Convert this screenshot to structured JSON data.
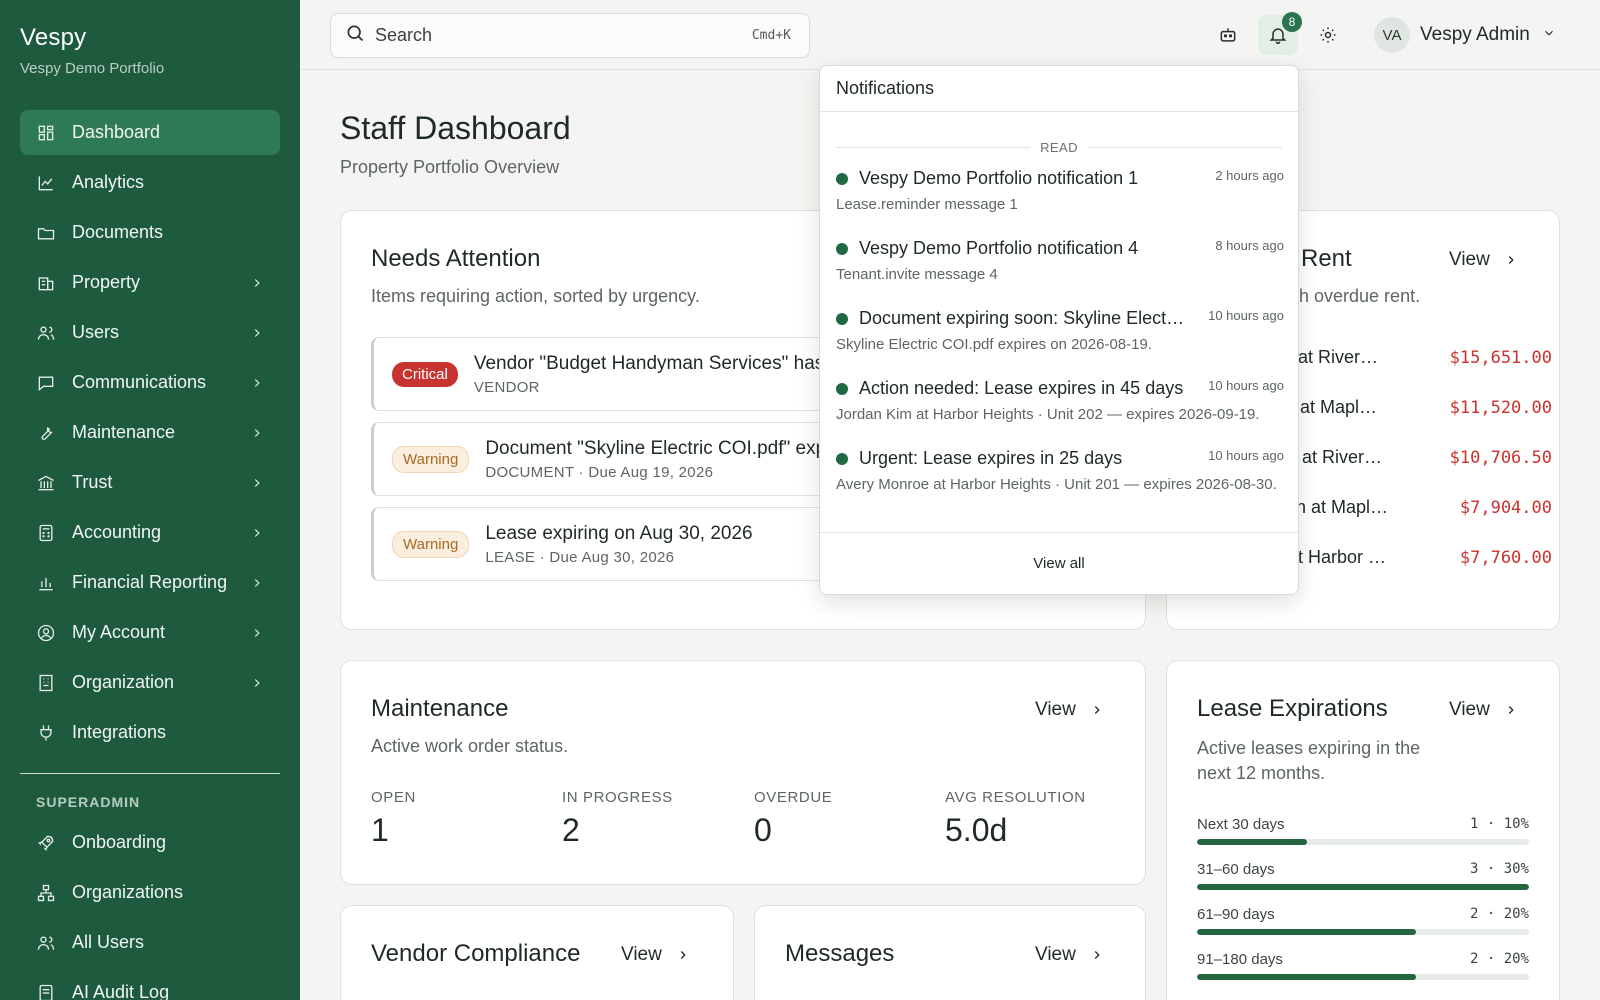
{
  "brand": {
    "title": "Vespy",
    "subtitle": "Vespy Demo Portfolio"
  },
  "sidebar": {
    "items": [
      {
        "label": "Dashboard",
        "icon": "dashboard-icon",
        "active": true,
        "chevron": false
      },
      {
        "label": "Analytics",
        "icon": "chart-line-icon",
        "chevron": false
      },
      {
        "label": "Documents",
        "icon": "folder-icon",
        "chevron": false
      },
      {
        "label": "Property",
        "icon": "building-icon",
        "chevron": true
      },
      {
        "label": "Users",
        "icon": "users-icon",
        "chevron": true
      },
      {
        "label": "Communications",
        "icon": "message-icon",
        "chevron": true
      },
      {
        "label": "Maintenance",
        "icon": "wrench-icon",
        "chevron": true
      },
      {
        "label": "Trust",
        "icon": "bank-icon",
        "chevron": true
      },
      {
        "label": "Accounting",
        "icon": "calculator-icon",
        "chevron": true
      },
      {
        "label": "Financial Reporting",
        "icon": "bar-chart-icon",
        "chevron": true
      },
      {
        "label": "My Account",
        "icon": "user-circle-icon",
        "chevron": true
      },
      {
        "label": "Organization",
        "icon": "office-icon",
        "chevron": true
      },
      {
        "label": "Integrations",
        "icon": "plug-icon",
        "chevron": false
      }
    ],
    "section_label": "SUPERADMIN",
    "admin_items": [
      {
        "label": "Onboarding",
        "icon": "rocket-icon"
      },
      {
        "label": "Organizations",
        "icon": "hierarchy-icon"
      },
      {
        "label": "All Users",
        "icon": "users-icon"
      },
      {
        "label": "AI Audit Log",
        "icon": "log-icon"
      }
    ]
  },
  "topbar": {
    "search_placeholder": "Search",
    "search_shortcut": "Cmd+K",
    "notification_count": "8",
    "user_initials": "VA",
    "user_name": "Vespy Admin"
  },
  "page": {
    "title": "Staff Dashboard",
    "subtitle": "Property Portfolio Overview"
  },
  "needs_attention": {
    "title": "Needs Attention",
    "subtitle": "Items requiring action, sorted by urgency.",
    "items": [
      {
        "severity": "Critical",
        "title": "Vendor \"Budget Handyman Services\" has",
        "meta": "VENDOR"
      },
      {
        "severity": "Warning",
        "title": "Document \"Skyline Electric COI.pdf\" exp",
        "meta": "DOCUMENT   · Due Aug 19, 2026"
      },
      {
        "severity": "Warning",
        "title": "Lease expiring on Aug 30, 2026",
        "meta": "LEASE   · Due Aug 30, 2026"
      }
    ]
  },
  "overdue_rent": {
    "title": "Rent",
    "view_label": "View",
    "subtitle": "h overdue rent.",
    "rows": [
      {
        "name": "er at River…",
        "amount": "$15,651.00"
      },
      {
        "name": "ks at Mapl…",
        "amount": "$11,520.00"
      },
      {
        "name": "ed at River…",
        "amount": "$10,706.50"
      },
      {
        "name": "yen at Mapl…",
        "amount": "$7,904.00"
      },
      {
        "name": "r at Harbor …",
        "amount": "$7,760.00"
      }
    ]
  },
  "maintenance": {
    "title": "Maintenance",
    "subtitle": "Active work order status.",
    "view_label": "View",
    "stats": [
      {
        "label": "OPEN",
        "value": "1"
      },
      {
        "label": "IN PROGRESS",
        "value": "2"
      },
      {
        "label": "OVERDUE",
        "value": "0"
      },
      {
        "label": "AVG RESOLUTION",
        "value": "5.0d"
      }
    ]
  },
  "lease_expirations": {
    "title": "Lease Expirations",
    "subtitle": "Active leases expiring in the next 12 months.",
    "view_label": "View",
    "rows": [
      {
        "label": "Next 30 days",
        "count": "1 · 10%",
        "fraction": 0.33
      },
      {
        "label": "31–60 days",
        "count": "3 · 30%",
        "fraction": 1.0
      },
      {
        "label": "61–90 days",
        "count": "2 · 20%",
        "fraction": 0.66
      },
      {
        "label": "91–180 days",
        "count": "2 · 20%",
        "fraction": 0.66
      }
    ]
  },
  "vendor_compliance": {
    "title": "Vendor Compliance",
    "view_label": "View"
  },
  "messages": {
    "title": "Messages",
    "view_label": "View"
  },
  "notifications": {
    "title": "Notifications",
    "section_label": "READ",
    "items": [
      {
        "title": "Vespy Demo Portfolio notification 1",
        "time": "2 hours ago",
        "message": "Lease.reminder message 1"
      },
      {
        "title": "Vespy Demo Portfolio notification 4",
        "time": "8 hours ago",
        "message": "Tenant.invite message 4"
      },
      {
        "title": "Document expiring soon: Skyline Electric COI.pdf",
        "time": "10 hours ago",
        "message": "Skyline Electric COI.pdf expires on 2026-08-19."
      },
      {
        "title": "Action needed: Lease expires in 45 days",
        "time": "10 hours ago",
        "message": "Jordan Kim at Harbor Heights · Unit 202 — expires 2026-09-19."
      },
      {
        "title": "Urgent: Lease expires in 25 days",
        "time": "10 hours ago",
        "message": "Avery Monroe at Harbor Heights · Unit 201 — expires 2026-08-30."
      }
    ],
    "view_all_label": "View all"
  },
  "colors": {
    "sidebar": "#1e5a3e",
    "active": "#2e7a55",
    "accent": "#1f6a44",
    "danger": "#c8332f",
    "warning_bg": "#fbeede"
  }
}
